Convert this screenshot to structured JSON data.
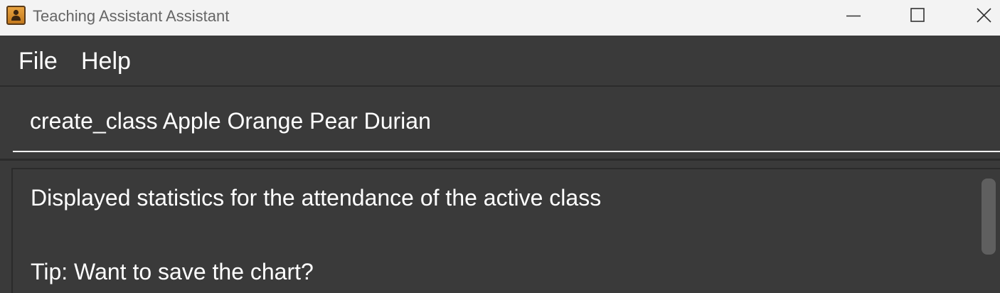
{
  "window": {
    "title": "Teaching Assistant Assistant",
    "app_icon": "person-contact-icon"
  },
  "menu": {
    "items": [
      {
        "label": "File"
      },
      {
        "label": "Help"
      }
    ]
  },
  "command_box": {
    "value": "create_class Apple Orange Pear Durian",
    "placeholder": ""
  },
  "result_display": {
    "lines": [
      "Displayed statistics for the attendance of the active class",
      "Tip: Want to save the chart?"
    ]
  },
  "colors": {
    "titlebar_bg": "#f3f3f3",
    "app_bg": "#3a3a3a",
    "border": "#2b2b2b",
    "text": "#ffffff",
    "icon_accent": "#d98b2b"
  }
}
